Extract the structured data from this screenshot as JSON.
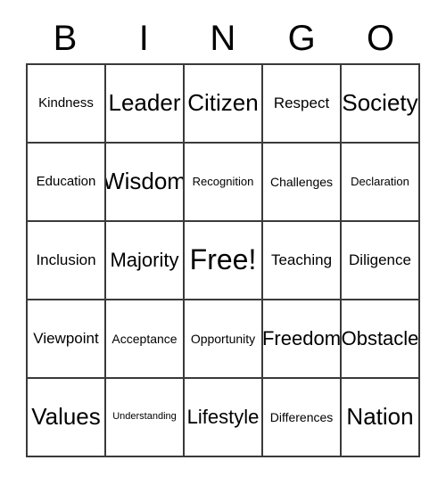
{
  "card": {
    "header_letters": [
      "B",
      "I",
      "N",
      "G",
      "O"
    ],
    "colors": {
      "background": "#ffffff",
      "text": "#000000",
      "grid_line": "#3a3a3a"
    },
    "rows": [
      [
        {
          "label": "Kindness",
          "size": "sz-m"
        },
        {
          "label": "Leader",
          "size": "sz-xl2"
        },
        {
          "label": "Citizen",
          "size": "sz-xl2"
        },
        {
          "label": "Respect",
          "size": "sz-m2"
        },
        {
          "label": "Society",
          "size": "sz-xl2"
        }
      ],
      [
        {
          "label": "Education",
          "size": "sz-m"
        },
        {
          "label": "Wisdom",
          "size": "sz-xl2"
        },
        {
          "label": "Recognition",
          "size": "sz-s"
        },
        {
          "label": "Challenges",
          "size": "sz-s2"
        },
        {
          "label": "Declaration",
          "size": "sz-s"
        }
      ],
      [
        {
          "label": "Inclusion",
          "size": "sz-m2"
        },
        {
          "label": "Majority",
          "size": "sz-l2"
        },
        {
          "label": "Free!",
          "size": "sz-xxl"
        },
        {
          "label": "Teaching",
          "size": "sz-m2"
        },
        {
          "label": "Diligence",
          "size": "sz-m2"
        }
      ],
      [
        {
          "label": "Viewpoint",
          "size": "sz-m2"
        },
        {
          "label": "Acceptance",
          "size": "sz-s2"
        },
        {
          "label": "Opportunity",
          "size": "sz-s2"
        },
        {
          "label": "Freedom",
          "size": "sz-l2"
        },
        {
          "label": "Obstacle",
          "size": "sz-l2"
        }
      ],
      [
        {
          "label": "Values",
          "size": "sz-xl2"
        },
        {
          "label": "Understanding",
          "size": "sz-xs"
        },
        {
          "label": "Lifestyle",
          "size": "sz-l2"
        },
        {
          "label": "Differences",
          "size": "sz-s2"
        },
        {
          "label": "Nation",
          "size": "sz-xl2"
        }
      ]
    ]
  }
}
